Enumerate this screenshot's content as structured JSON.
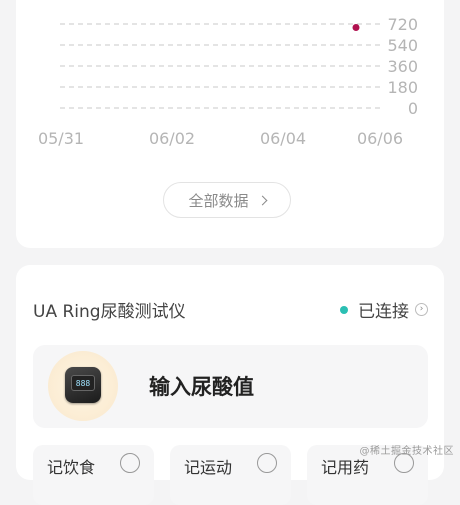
{
  "chart_data": {
    "type": "scatter",
    "x_tick_labels": [
      "05/31",
      "06/02",
      "06/04",
      "06/06"
    ],
    "y_tick_labels": [
      "720",
      "540",
      "360",
      "180",
      "0"
    ],
    "ylim": [
      0,
      720
    ],
    "grid": true,
    "points": [
      {
        "x": "06/06",
        "y": 690
      }
    ],
    "point_color": "#b0114f"
  },
  "chart_footer": {
    "all_data_label": "全部数据"
  },
  "device": {
    "title": "UA Ring尿酸测试仪",
    "status": "已连接",
    "status_color": "#2bbfb3",
    "input_label": "输入尿酸值",
    "screen_text": "888",
    "mini_cards": [
      {
        "label": "记饮食",
        "icon": "plus-circle-icon"
      },
      {
        "label": "记运动",
        "icon": "plus-circle-icon"
      },
      {
        "label": "记用药",
        "icon": "plus-circle-icon"
      }
    ]
  },
  "watermark": "@稀土掘金技术社区"
}
